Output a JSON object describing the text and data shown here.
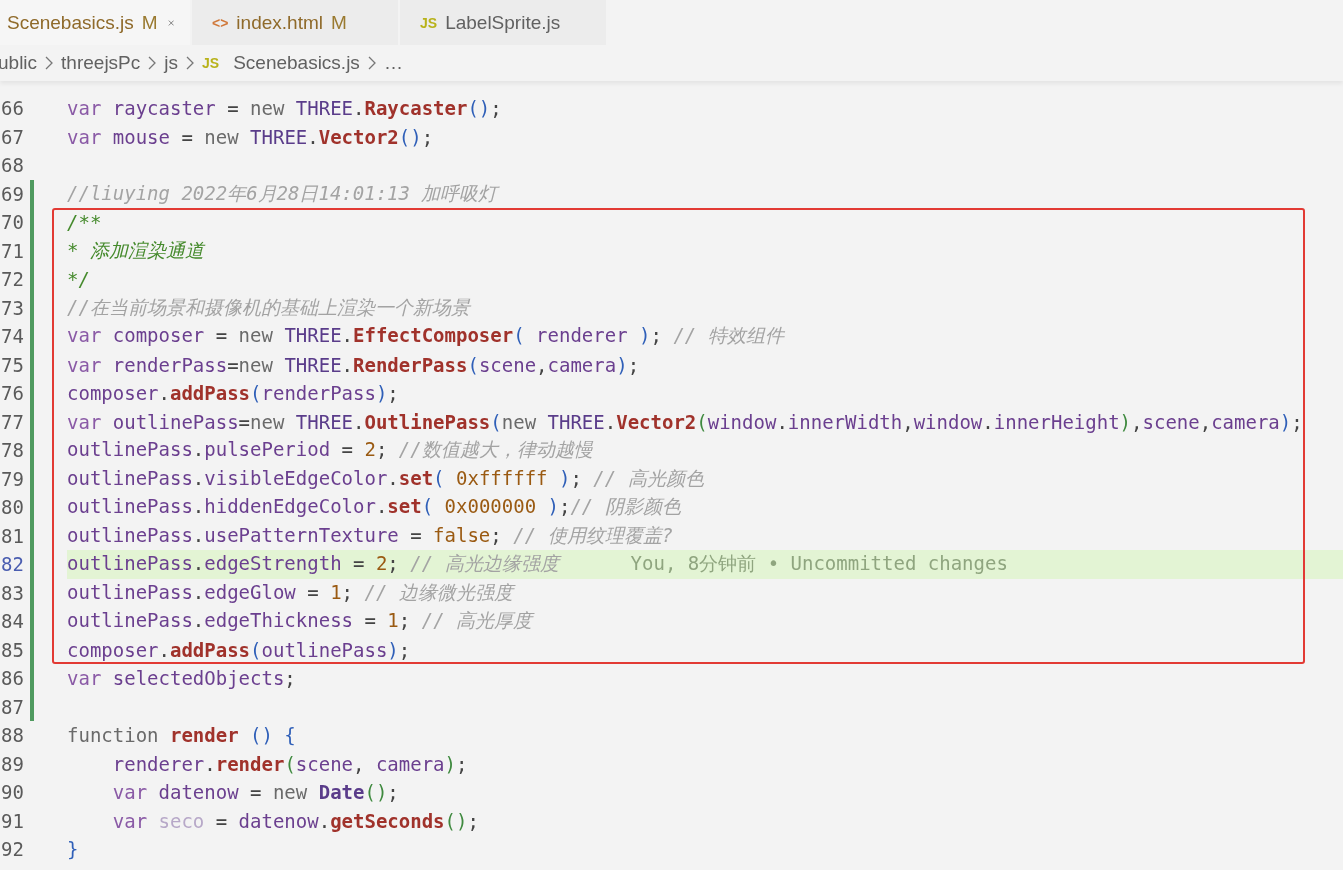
{
  "tabs": [
    {
      "label": "Scenebasics.js",
      "modified": "M",
      "selected": true,
      "closable": true
    },
    {
      "label": "index.html",
      "icon": {
        "kind": "html",
        "text": "<>"
      },
      "modified": "M",
      "selected": false,
      "closable": false
    },
    {
      "label": "LabelSprite.js",
      "icon": {
        "kind": "js",
        "text": "JS"
      },
      "selected": false,
      "closable": false
    }
  ],
  "breadcrumb": [
    {
      "label": "ublic"
    },
    {
      "label": "threejsPc"
    },
    {
      "label": "js"
    },
    {
      "label": "Scenebasics.js",
      "icon": {
        "kind": "js",
        "text": "JS"
      }
    },
    {
      "label": "…"
    }
  ],
  "lines": [
    {
      "number": "66",
      "changed": false,
      "boxed": false,
      "current": false,
      "tokens": [
        {
          "kind": "k",
          "text": "var "
        },
        {
          "kind": "i",
          "text": "raycaster"
        },
        {
          "kind": "p",
          "text": " = "
        },
        {
          "kind": "n",
          "text": "new "
        },
        {
          "kind": "c",
          "text": "THREE"
        },
        {
          "kind": "p",
          "text": "."
        },
        {
          "kind": "f",
          "text": "Raycaster"
        },
        {
          "kind": "b",
          "text": "()"
        },
        {
          "kind": "p",
          "text": ";"
        }
      ]
    },
    {
      "number": "67",
      "changed": false,
      "boxed": false,
      "current": false,
      "tokens": [
        {
          "kind": "k",
          "text": "var "
        },
        {
          "kind": "i",
          "text": "mouse"
        },
        {
          "kind": "p",
          "text": " = "
        },
        {
          "kind": "n",
          "text": "new "
        },
        {
          "kind": "c",
          "text": "THREE"
        },
        {
          "kind": "p",
          "text": "."
        },
        {
          "kind": "f",
          "text": "Vector2"
        },
        {
          "kind": "b",
          "text": "()"
        },
        {
          "kind": "p",
          "text": ";"
        }
      ]
    },
    {
      "number": "68",
      "changed": false,
      "boxed": false,
      "current": false
    },
    {
      "number": "69",
      "changed": true,
      "boxed": false,
      "current": false,
      "tokens": [
        {
          "kind": "m",
          "text": "//liuying 2022年6月28日14:01:13 加呼吸灯"
        }
      ]
    },
    {
      "number": "70",
      "changed": true,
      "boxed": true,
      "current": false,
      "tokens": [
        {
          "kind": "doc",
          "text": "/**"
        }
      ]
    },
    {
      "number": "71",
      "changed": true,
      "boxed": true,
      "current": false,
      "tokens": [
        {
          "kind": "doc",
          "text": "* 添加渲染通道"
        }
      ]
    },
    {
      "number": "72",
      "changed": true,
      "boxed": true,
      "current": false,
      "tokens": [
        {
          "kind": "doc",
          "text": "*/"
        }
      ]
    },
    {
      "number": "73",
      "changed": true,
      "boxed": true,
      "current": false,
      "tokens": [
        {
          "kind": "m",
          "text": "//在当前场景和摄像机的基础上渲染一个新场景"
        }
      ]
    },
    {
      "number": "74",
      "changed": true,
      "boxed": true,
      "current": false,
      "tokens": [
        {
          "kind": "k",
          "text": "var "
        },
        {
          "kind": "i",
          "text": "composer"
        },
        {
          "kind": "p",
          "text": " = "
        },
        {
          "kind": "n",
          "text": "new "
        },
        {
          "kind": "c",
          "text": "THREE"
        },
        {
          "kind": "p",
          "text": "."
        },
        {
          "kind": "f",
          "text": "EffectComposer"
        },
        {
          "kind": "b",
          "text": "("
        },
        {
          "kind": "i",
          "text": " renderer "
        },
        {
          "kind": "b",
          "text": ")"
        },
        {
          "kind": "p",
          "text": "; "
        },
        {
          "kind": "m",
          "text": "// 特效组件"
        }
      ]
    },
    {
      "number": "75",
      "changed": true,
      "boxed": true,
      "current": false,
      "tokens": [
        {
          "kind": "k",
          "text": "var "
        },
        {
          "kind": "i",
          "text": "renderPass"
        },
        {
          "kind": "p",
          "text": "="
        },
        {
          "kind": "n",
          "text": "new "
        },
        {
          "kind": "c",
          "text": "THREE"
        },
        {
          "kind": "p",
          "text": "."
        },
        {
          "kind": "f",
          "text": "RenderPass"
        },
        {
          "kind": "b",
          "text": "("
        },
        {
          "kind": "i",
          "text": "scene"
        },
        {
          "kind": "p",
          "text": ","
        },
        {
          "kind": "i",
          "text": "camera"
        },
        {
          "kind": "b",
          "text": ")"
        },
        {
          "kind": "p",
          "text": ";"
        }
      ]
    },
    {
      "number": "76",
      "changed": true,
      "boxed": true,
      "current": false,
      "tokens": [
        {
          "kind": "i",
          "text": "composer"
        },
        {
          "kind": "p",
          "text": "."
        },
        {
          "kind": "f",
          "text": "addPass"
        },
        {
          "kind": "b",
          "text": "("
        },
        {
          "kind": "i",
          "text": "renderPass"
        },
        {
          "kind": "b",
          "text": ")"
        },
        {
          "kind": "p",
          "text": ";"
        }
      ]
    },
    {
      "number": "77",
      "changed": true,
      "boxed": true,
      "current": false,
      "tokens": [
        {
          "kind": "k",
          "text": "var "
        },
        {
          "kind": "i",
          "text": "outlinePass"
        },
        {
          "kind": "p",
          "text": "="
        },
        {
          "kind": "n",
          "text": "new "
        },
        {
          "kind": "c",
          "text": "THREE"
        },
        {
          "kind": "p",
          "text": "."
        },
        {
          "kind": "f",
          "text": "OutlinePass"
        },
        {
          "kind": "b",
          "text": "("
        },
        {
          "kind": "n",
          "text": "new "
        },
        {
          "kind": "c",
          "text": "THREE"
        },
        {
          "kind": "p",
          "text": "."
        },
        {
          "kind": "f",
          "text": "Vector2"
        },
        {
          "kind": "g",
          "text": "("
        },
        {
          "kind": "i",
          "text": "window"
        },
        {
          "kind": "p",
          "text": "."
        },
        {
          "kind": "i",
          "text": "innerWidth"
        },
        {
          "kind": "p",
          "text": ","
        },
        {
          "kind": "i",
          "text": "window"
        },
        {
          "kind": "p",
          "text": "."
        },
        {
          "kind": "i",
          "text": "innerHeight"
        },
        {
          "kind": "g",
          "text": ")"
        },
        {
          "kind": "p",
          "text": ","
        },
        {
          "kind": "i",
          "text": "scene"
        },
        {
          "kind": "p",
          "text": ","
        },
        {
          "kind": "i",
          "text": "camera"
        },
        {
          "kind": "b",
          "text": ")"
        },
        {
          "kind": "p",
          "text": ";"
        }
      ]
    },
    {
      "number": "78",
      "changed": true,
      "boxed": true,
      "current": false,
      "tokens": [
        {
          "kind": "i",
          "text": "outlinePass"
        },
        {
          "kind": "p",
          "text": "."
        },
        {
          "kind": "i",
          "text": "pulsePeriod"
        },
        {
          "kind": "p",
          "text": " = "
        },
        {
          "kind": "d",
          "text": "2"
        },
        {
          "kind": "p",
          "text": "; "
        },
        {
          "kind": "m",
          "text": "//数值越大，律动越慢"
        }
      ]
    },
    {
      "number": "79",
      "changed": true,
      "boxed": true,
      "current": false,
      "tokens": [
        {
          "kind": "i",
          "text": "outlinePass"
        },
        {
          "kind": "p",
          "text": "."
        },
        {
          "kind": "i",
          "text": "visibleEdgeColor"
        },
        {
          "kind": "p",
          "text": "."
        },
        {
          "kind": "f",
          "text": "set"
        },
        {
          "kind": "b",
          "text": "("
        },
        {
          "kind": "d",
          "text": " 0xffffff "
        },
        {
          "kind": "b",
          "text": ")"
        },
        {
          "kind": "p",
          "text": "; "
        },
        {
          "kind": "m",
          "text": "// 高光颜色"
        }
      ]
    },
    {
      "number": "80",
      "changed": true,
      "boxed": true,
      "current": false,
      "tokens": [
        {
          "kind": "i",
          "text": "outlinePass"
        },
        {
          "kind": "p",
          "text": "."
        },
        {
          "kind": "i",
          "text": "hiddenEdgeColor"
        },
        {
          "kind": "p",
          "text": "."
        },
        {
          "kind": "f",
          "text": "set"
        },
        {
          "kind": "b",
          "text": "("
        },
        {
          "kind": "d",
          "text": " 0x000000 "
        },
        {
          "kind": "b",
          "text": ")"
        },
        {
          "kind": "p",
          "text": ";"
        },
        {
          "kind": "m",
          "text": "// 阴影颜色"
        }
      ]
    },
    {
      "number": "81",
      "changed": true,
      "boxed": true,
      "current": false,
      "tokens": [
        {
          "kind": "i",
          "text": "outlinePass"
        },
        {
          "kind": "p",
          "text": "."
        },
        {
          "kind": "i",
          "text": "usePatternTexture"
        },
        {
          "kind": "p",
          "text": " = "
        },
        {
          "kind": "d",
          "text": "false"
        },
        {
          "kind": "p",
          "text": "; "
        },
        {
          "kind": "m",
          "text": "// 使用纹理覆盖?"
        }
      ]
    },
    {
      "number": "82",
      "changed": true,
      "boxed": true,
      "current": true,
      "blame": "You, 8分钟前 • Uncommitted changes",
      "tokens": [
        {
          "kind": "i",
          "text": "outlinePass"
        },
        {
          "kind": "p",
          "text": "."
        },
        {
          "kind": "i",
          "text": "edgeStrength"
        },
        {
          "kind": "p",
          "text": " = "
        },
        {
          "kind": "d",
          "text": "2"
        },
        {
          "kind": "p",
          "text": "; "
        },
        {
          "kind": "m",
          "text": "// 高光边缘强度"
        }
      ]
    },
    {
      "number": "83",
      "changed": true,
      "boxed": true,
      "current": false,
      "tokens": [
        {
          "kind": "i",
          "text": "outlinePass"
        },
        {
          "kind": "p",
          "text": "."
        },
        {
          "kind": "i",
          "text": "edgeGlow"
        },
        {
          "kind": "p",
          "text": " = "
        },
        {
          "kind": "d",
          "text": "1"
        },
        {
          "kind": "p",
          "text": "; "
        },
        {
          "kind": "m",
          "text": "// 边缘微光强度"
        }
      ]
    },
    {
      "number": "84",
      "changed": true,
      "boxed": true,
      "current": false,
      "tokens": [
        {
          "kind": "i",
          "text": "outlinePass"
        },
        {
          "kind": "p",
          "text": "."
        },
        {
          "kind": "i",
          "text": "edgeThickness"
        },
        {
          "kind": "p",
          "text": " = "
        },
        {
          "kind": "d",
          "text": "1"
        },
        {
          "kind": "p",
          "text": "; "
        },
        {
          "kind": "m",
          "text": "// 高光厚度"
        }
      ]
    },
    {
      "number": "85",
      "changed": true,
      "boxed": true,
      "current": false,
      "tokens": [
        {
          "kind": "i",
          "text": "composer"
        },
        {
          "kind": "p",
          "text": "."
        },
        {
          "kind": "f",
          "text": "addPass"
        },
        {
          "kind": "b",
          "text": "("
        },
        {
          "kind": "i",
          "text": "outlinePass"
        },
        {
          "kind": "b",
          "text": ")"
        },
        {
          "kind": "p",
          "text": ";"
        }
      ]
    },
    {
      "number": "86",
      "changed": true,
      "boxed": false,
      "current": false,
      "tokens": [
        {
          "kind": "k",
          "text": "var "
        },
        {
          "kind": "i",
          "text": "selectedObjects"
        },
        {
          "kind": "p",
          "text": ";"
        }
      ]
    },
    {
      "number": "87",
      "changed": true,
      "boxed": false,
      "current": false
    },
    {
      "number": "88",
      "changed": false,
      "boxed": false,
      "current": false,
      "tokens": [
        {
          "kind": "n",
          "text": "function "
        },
        {
          "kind": "f",
          "text": "render"
        },
        {
          "kind": "b",
          "text": " ()"
        },
        {
          "kind": "b",
          "text": " {"
        }
      ]
    },
    {
      "number": "89",
      "changed": false,
      "boxed": false,
      "current": false,
      "tokens": [
        {
          "kind": "i",
          "text": "    renderer"
        },
        {
          "kind": "p",
          "text": "."
        },
        {
          "kind": "f",
          "text": "render"
        },
        {
          "kind": "g",
          "text": "("
        },
        {
          "kind": "i",
          "text": "scene"
        },
        {
          "kind": "p",
          "text": ", "
        },
        {
          "kind": "i",
          "text": "camera"
        },
        {
          "kind": "g",
          "text": ")"
        },
        {
          "kind": "p",
          "text": ";"
        }
      ]
    },
    {
      "number": "90",
      "changed": false,
      "boxed": false,
      "current": false,
      "tokens": [
        {
          "kind": "k",
          "text": "    var "
        },
        {
          "kind": "i",
          "text": "datenow"
        },
        {
          "kind": "p",
          "text": " = "
        },
        {
          "kind": "n",
          "text": "new "
        },
        {
          "kind": "t",
          "text": "Date"
        },
        {
          "kind": "g",
          "text": "()"
        },
        {
          "kind": "p",
          "text": ";"
        }
      ]
    },
    {
      "number": "91",
      "changed": false,
      "boxed": false,
      "current": false,
      "tokens": [
        {
          "kind": "k",
          "text": "    var "
        },
        {
          "kind": "u",
          "text": "seco"
        },
        {
          "kind": "p",
          "text": " = "
        },
        {
          "kind": "i",
          "text": "datenow"
        },
        {
          "kind": "p",
          "text": "."
        },
        {
          "kind": "f",
          "text": "getSeconds"
        },
        {
          "kind": "g",
          "text": "()"
        },
        {
          "kind": "p",
          "text": ";"
        }
      ]
    },
    {
      "number": "92",
      "changed": false,
      "boxed": false,
      "current": false,
      "tokens": [
        {
          "kind": "b",
          "text": "}"
        }
      ]
    }
  ]
}
